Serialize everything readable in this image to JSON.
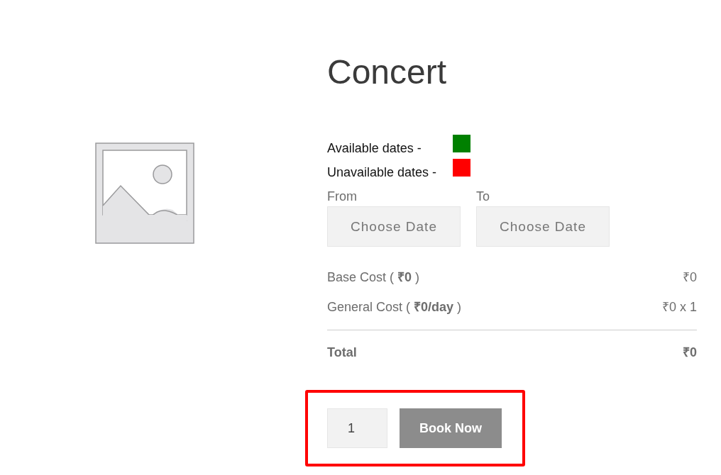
{
  "product": {
    "title": "Concert"
  },
  "legend": [
    {
      "label": "Available dates -",
      "color": "#008000"
    },
    {
      "label": "Unavailable dates -",
      "color": "#ff0000"
    }
  ],
  "date_range": [
    {
      "label": "From",
      "placeholder": "Choose Date"
    },
    {
      "label": "To",
      "placeholder": "Choose Date"
    }
  ],
  "costs": [
    {
      "label": "Base Cost ( **₹0** )",
      "value": "₹0"
    },
    {
      "label": "General Cost ( **₹0/day** )",
      "value": "₹0 x 1"
    }
  ],
  "total": {
    "label": "Total",
    "value": "₹0"
  },
  "booking": {
    "highlighted": true,
    "quantity": "1",
    "button": "Book Now"
  }
}
